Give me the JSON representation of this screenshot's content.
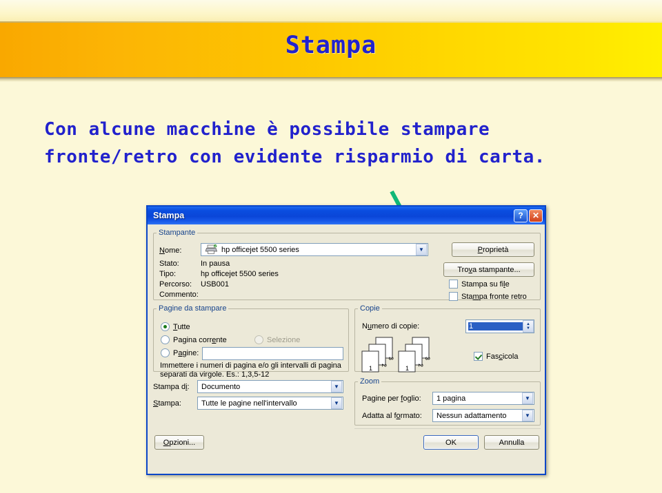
{
  "slide": {
    "title": "Stampa",
    "body_line1": "Con alcune macchine è possibile stampare",
    "body_line2": "fronte/retro con evidente risparmio di carta.",
    "title_color": "#2222cc",
    "banner_color_left": "#f9a800",
    "banner_color_right": "#fff000",
    "background_color": "#fcf8d8",
    "arrow_color": "#11b878"
  },
  "dialog": {
    "title": "Stampa",
    "help_label": "?",
    "close_label": "✕",
    "printer": {
      "group_label": "Stampante",
      "name_label": "Nome:",
      "name_value": "hp officejet 5500 series",
      "status_label": "Stato:",
      "status_value": "In pausa",
      "type_label": "Tipo:",
      "type_value": "hp officejet 5500 series",
      "where_label": "Percorso:",
      "where_value": "USB001",
      "comment_label": "Commento:",
      "comment_value": "",
      "properties_button": "Proprietà",
      "find_printer_button": "Trova stampante...",
      "print_to_file_label": "Stampa su file",
      "print_to_file_checked": false,
      "duplex_label": "Stampa fronte retro",
      "duplex_checked": false
    },
    "page_range": {
      "group_label": "Pagine da stampare",
      "all_label": "Tutte",
      "all_selected": true,
      "current_label": "Pagina corrente",
      "current_selected": false,
      "selection_label": "Selezione",
      "selection_selected": false,
      "selection_disabled": true,
      "pages_label": "Pagine:",
      "pages_selected": false,
      "pages_value": "",
      "hint": "Immettere i numeri di pagina e/o gli intervalli di pagina separati da virgole. Es.: 1,3,5-12"
    },
    "copies": {
      "group_label": "Copie",
      "number_label": "Numero di copie:",
      "number_value": "1",
      "collate_label": "Fascicola",
      "collate_checked": true,
      "stack_page_numbers": [
        "3",
        "2",
        "1"
      ]
    },
    "print_what": {
      "print_what_label": "Stampa di:",
      "print_what_value": "Documento",
      "print_range_label": "Stampa:",
      "print_range_value": "Tutte le pagine nell'intervallo"
    },
    "zoom": {
      "group_label": "Zoom",
      "pages_per_sheet_label": "Pagine per foglio:",
      "pages_per_sheet_value": "1 pagina",
      "scale_to_paper_label": "Adatta al formato:",
      "scale_to_paper_value": "Nessun adattamento"
    },
    "footer": {
      "options_button": "Opzioni...",
      "ok_button": "OK",
      "cancel_button": "Annulla"
    }
  }
}
